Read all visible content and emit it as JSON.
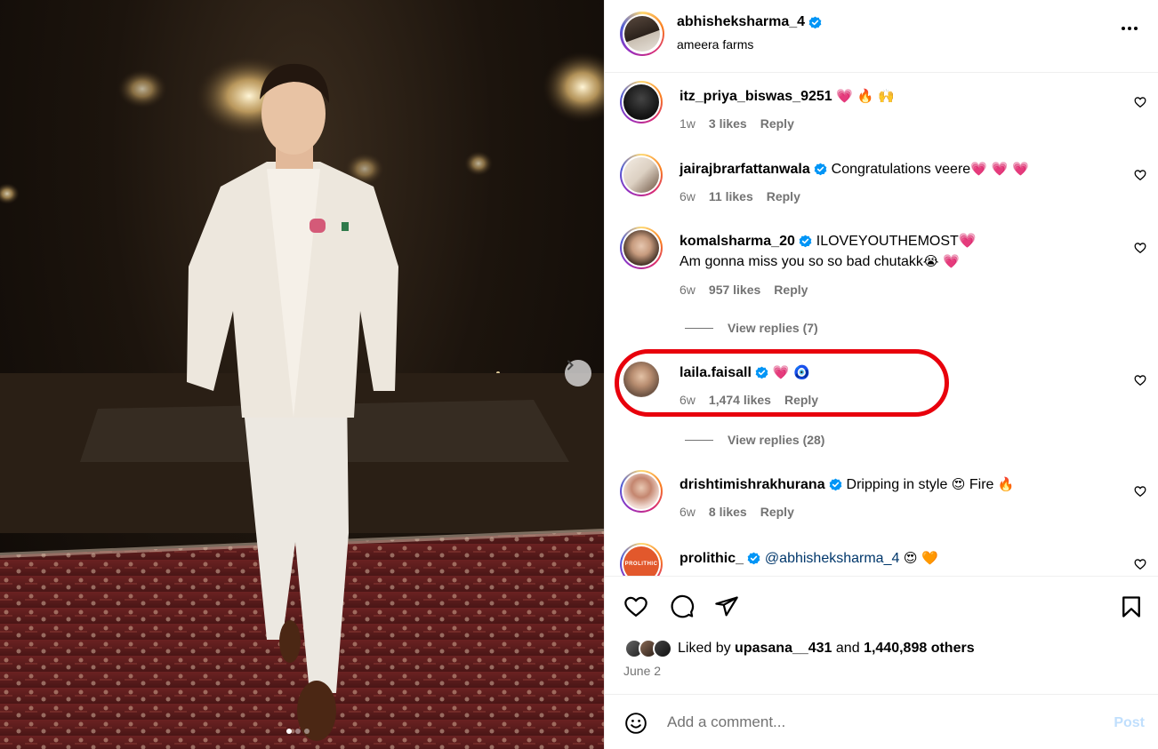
{
  "post": {
    "author": "abhisheksharma_4",
    "location": "ameera farms",
    "carousel_total": 3,
    "carousel_active": 1
  },
  "comments": [
    {
      "user": "itz_priya_biswas_9251",
      "verified": false,
      "text": "",
      "emojis": "💗 🔥 🙌",
      "time": "1w",
      "likes": "3 likes",
      "reply": "Reply"
    },
    {
      "user": "jairajbrarfattanwala",
      "verified": true,
      "text": "Congratulations veere",
      "emojis": "💗 💗 💗",
      "time": "6w",
      "likes": "11 likes",
      "reply": "Reply"
    },
    {
      "user": "komalsharma_20",
      "verified": true,
      "text": "ILOVEYOUTHEMOST💗",
      "text2": "Am gonna miss you so so bad chutakk",
      "emojis2": "😭 💗",
      "time": "6w",
      "likes": "957 likes",
      "reply": "Reply",
      "view_replies": "View replies (7)"
    },
    {
      "user": "laila.faisall",
      "verified": true,
      "text": "",
      "emojis": "💗 🧿",
      "time": "6w",
      "likes": "1,474 likes",
      "reply": "Reply",
      "view_replies": "View replies (28)"
    },
    {
      "user": "drishtimishrakhurana",
      "verified": true,
      "text": "Dripping in style",
      "emojis": "😍",
      "text_b": "Fire",
      "emojis_b": "🔥",
      "time": "6w",
      "likes": "8 likes",
      "reply": "Reply"
    },
    {
      "user": "prolithic_",
      "verified": true,
      "mention": "@abhisheksharma_4",
      "emojis": "😍 🧡",
      "avatar_text": "PROLITHIC"
    }
  ],
  "footer": {
    "liked_by_prefix": "Liked by",
    "liked_by_user": "upasana__431",
    "liked_by_mid": "and",
    "liked_by_count": "1,440,898 others",
    "date": "June 2",
    "comment_placeholder": "Add a comment...",
    "post_label": "Post"
  },
  "colors": {
    "verified_blue": "#0095f6",
    "highlight_red": "#e8000c",
    "muted": "#737373",
    "post_disabled": "#c0dffd"
  }
}
